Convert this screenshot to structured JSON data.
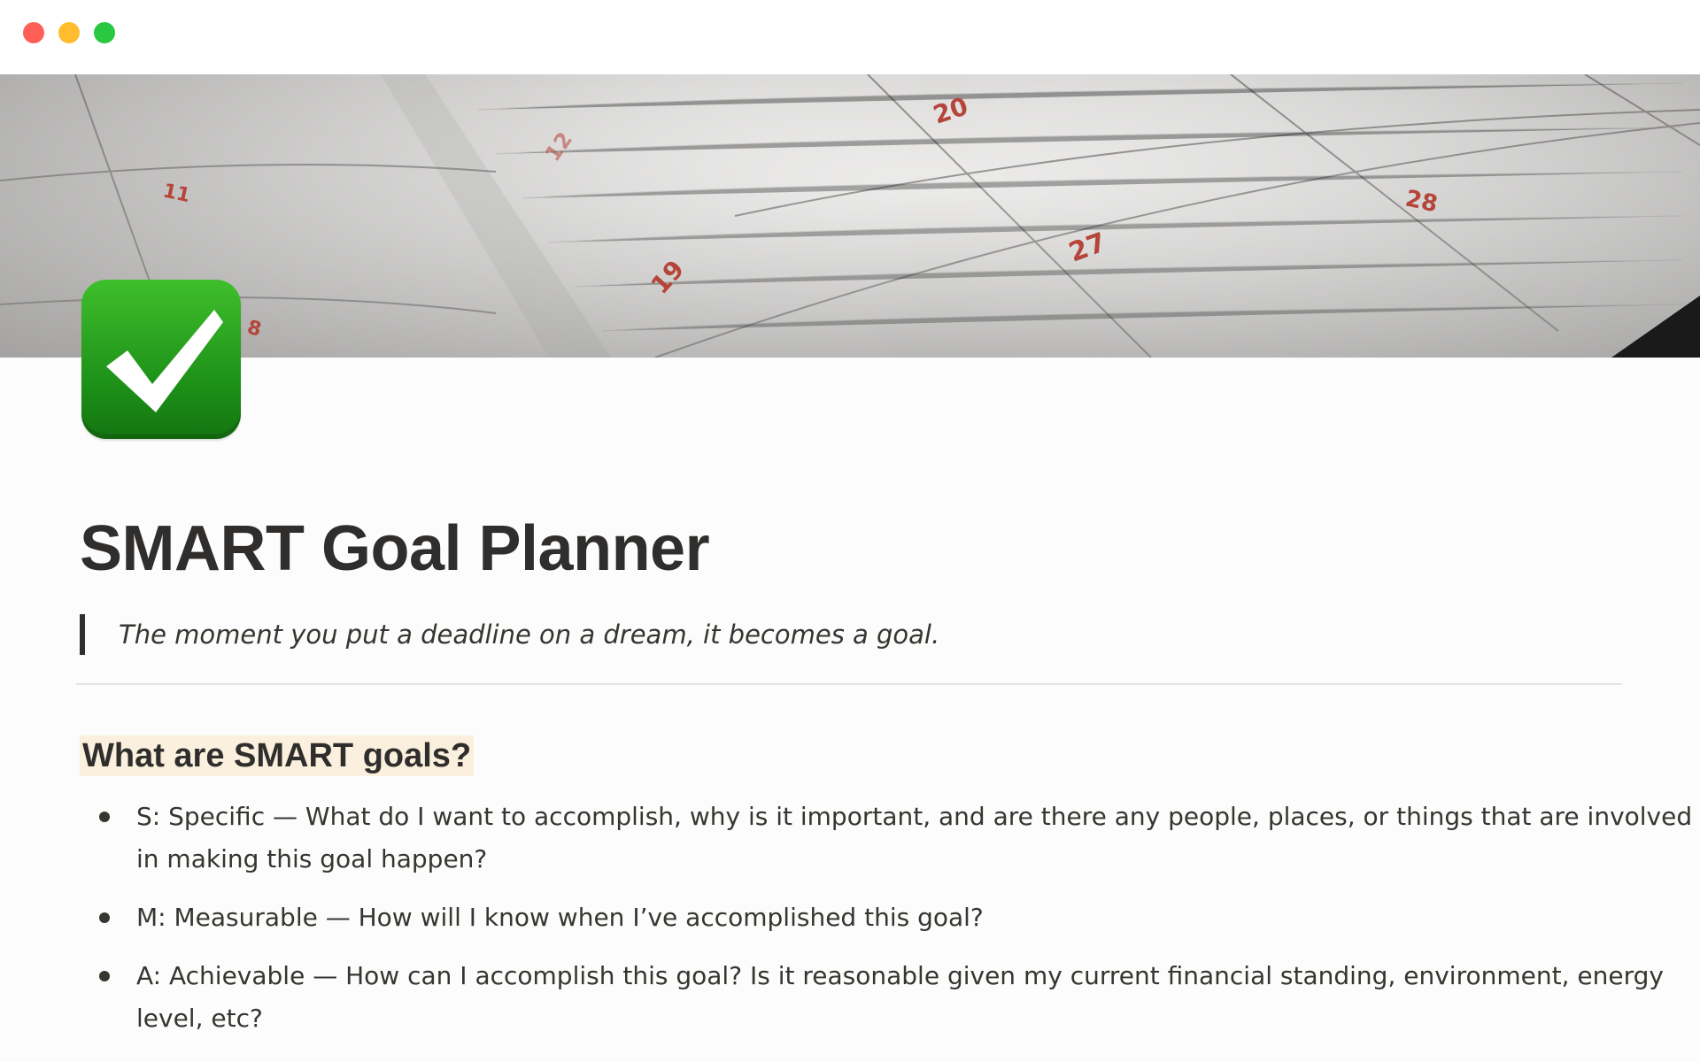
{
  "window": {
    "controls": [
      "close",
      "minimize",
      "maximize"
    ]
  },
  "cover": {
    "calendar_numbers": [
      "11",
      "8",
      "12",
      "19",
      "20",
      "27",
      "28"
    ]
  },
  "page": {
    "icon": "white-heavy-check-mark-icon",
    "title": "SMART Goal Planner",
    "quote": "The moment you put a deadline on a dream, it becomes a goal."
  },
  "section": {
    "heading": "What are SMART goals?",
    "items": [
      {
        "text": "S: Specific — What do I want to accomplish, why is it important, and are there any people, places, or things that are involved in making this goal happen?"
      },
      {
        "text": "M: Measurable — How will I know when I’ve accomplished this goal?"
      },
      {
        "text": "A: Achievable — How can I accomplish this goal? Is it reasonable given my current financial standing, environment, energy level, etc?"
      }
    ]
  },
  "colors": {
    "heading_highlight": "#fbf0dd",
    "icon_green": "#2aa51f",
    "calendar_number_red": "#b5453a"
  }
}
